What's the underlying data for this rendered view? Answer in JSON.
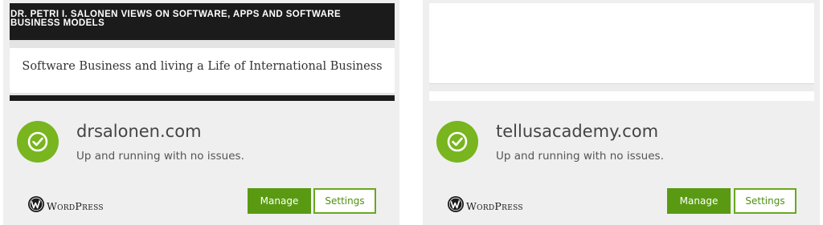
{
  "colors": {
    "accent_green": "#78b51e",
    "button_green": "#5a9a13",
    "card_bg": "#efefef",
    "dark_header": "#1b1b1b"
  },
  "sites": [
    {
      "preview": {
        "site_title": "DR. PETRI I. SALONEN VIEWS ON SOFTWARE, APPS AND SOFTWARE BUSINESS MODELS",
        "tagline": "Software Business and living a Life of International Business"
      },
      "status_icon": "check-circle-icon",
      "domain": "drsalonen.com",
      "status": "Up and running with no issues.",
      "platform_icon": "wordpress-icon",
      "platform": "WordPress",
      "manage_label": "Manage",
      "settings_label": "Settings"
    },
    {
      "status_icon": "check-circle-icon",
      "domain": "tellusacademy.com",
      "status": "Up and running with no issues.",
      "platform_icon": "wordpress-icon",
      "platform": "WordPress",
      "manage_label": "Manage",
      "settings_label": "Settings"
    }
  ]
}
